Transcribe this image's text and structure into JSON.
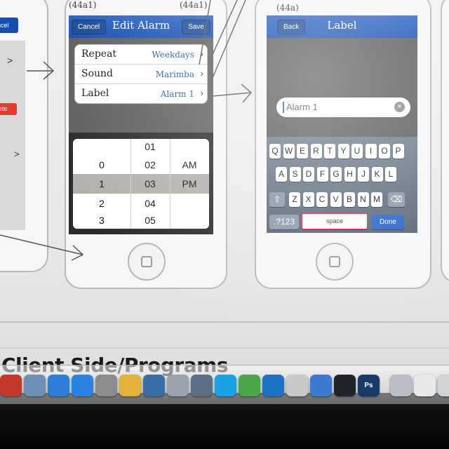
{
  "figure_labels": {
    "edit_alarm": "(44a1)",
    "label_screen": "(44a)"
  },
  "left_panel": {
    "cancel": "ncel",
    "delete": "ete",
    "chevron": ">"
  },
  "edit_alarm": {
    "title": "Edit Alarm",
    "cancel_label": "Cancel",
    "save_label": "Save",
    "rows": [
      {
        "label": "Repeat",
        "value": "Weekdays"
      },
      {
        "label": "Sound",
        "value": "Marimba"
      },
      {
        "label": "Label",
        "value": "Alarm 1"
      }
    ],
    "picker": {
      "col_hour": [
        "",
        "0",
        "1",
        "2",
        "3"
      ],
      "col_minute": [
        "01",
        "02",
        "03",
        "04",
        "05"
      ],
      "col_ampm": [
        "",
        "AM",
        "PM",
        "",
        ""
      ],
      "selected_index": 2
    }
  },
  "label_screen": {
    "title": "Label",
    "back_label": "Back",
    "field_value": "Alarm 1",
    "keyboard": {
      "row1": [
        "Q",
        "W",
        "E",
        "R",
        "T",
        "Y",
        "U",
        "I",
        "O",
        "P"
      ],
      "row2": [
        "A",
        "S",
        "D",
        "F",
        "G",
        "H",
        "J",
        "K",
        "L"
      ],
      "row3": [
        "Z",
        "X",
        "C",
        "V",
        "B",
        "N",
        "M"
      ],
      "numbers_key": ".?123",
      "space_key": "space",
      "done_key": "Done"
    }
  },
  "section_heading": "Client Side/Programs",
  "dock": {
    "apps": [
      {
        "name": "Photo Booth",
        "color": "#c0392b"
      },
      {
        "name": "iPhoto",
        "color": "#6d8fb3"
      },
      {
        "name": "iTunes",
        "color": "#2f7fd8"
      },
      {
        "name": "App Store",
        "color": "#2a84e0"
      },
      {
        "name": "Image Capture",
        "color": "#8c8c8c"
      },
      {
        "name": "Chrome",
        "color": "#e0b23a"
      },
      {
        "name": "Xcode",
        "color": "#3a6ea8"
      },
      {
        "name": "Installer",
        "color": "#9aa3ab"
      },
      {
        "name": "Preview",
        "color": "#5b6f86"
      },
      {
        "name": "Skype",
        "color": "#19a3e6"
      },
      {
        "name": "uTorrent",
        "color": "#4aa84a"
      },
      {
        "name": "TeamViewer",
        "color": "#1f73c6"
      },
      {
        "name": "Photos",
        "color": "#c9c9c9"
      },
      {
        "name": "Simulator",
        "color": "#3b7bd1"
      },
      {
        "name": "iPhone Simulator",
        "color": "#20232a"
      },
      {
        "name": "Photoshop",
        "color": "#173a6b",
        "text": "Ps"
      },
      {
        "name": "Downloads",
        "color": "#b9bec4"
      },
      {
        "name": "Documents",
        "color": "#e8e8e8"
      },
      {
        "name": "Trash",
        "color": "#cfd3d6"
      }
    ]
  }
}
